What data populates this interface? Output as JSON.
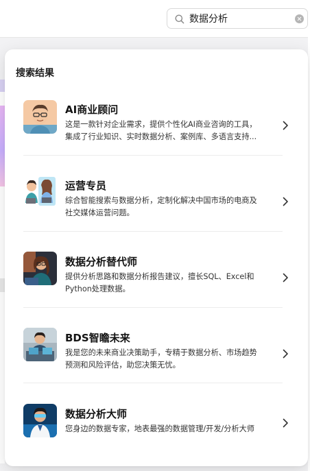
{
  "search": {
    "value": "数据分析"
  },
  "panel": {
    "title": "搜索结果"
  },
  "results": [
    {
      "title": "AI商业顾问",
      "desc_line1": "这是一款针对企业需求，提供个性化AI商业咨询的工具，",
      "desc_line2": "集成了行业知识、实时数据分析、案例库、多语言支持..."
    },
    {
      "title": "运营专员",
      "desc_line1": "综合智能搜索与数据分析，定制化解决中国市场的电商及",
      "desc_line2": "社交媒体运营问题。"
    },
    {
      "title": "数据分析替代师",
      "desc_line1": "提供分析思路和数据分析报告建议，擅长SQL、Excel和",
      "desc_line2": "Python处理数据。"
    },
    {
      "title": "BDS智瞻未来",
      "desc_line1": "我是您的未来商业决策助手，专精于数据分析、市场趋势",
      "desc_line2": "预测和风险评估，助您决策无忧。"
    },
    {
      "title": "数据分析大师",
      "desc_line1": "您身边的数据专家，地表最强的数据管理/开发/分析大师",
      "desc_line2": ""
    }
  ],
  "colors": {
    "panel_bg": "#ffffff",
    "page_bg": "#f2f2f4",
    "title_text": "#141414",
    "desc_text": "#333333",
    "divider": "#ececec"
  },
  "icons": [
    "search-icon",
    "clear-icon",
    "chevron-right-icon"
  ]
}
